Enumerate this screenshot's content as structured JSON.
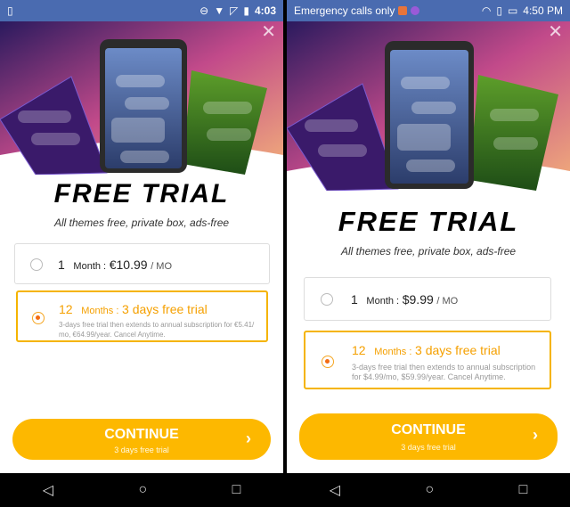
{
  "left": {
    "statusbar": {
      "time": "4:03"
    },
    "title": "FREE  TRIAL",
    "subtitle": "All themes free, private box, ads-free",
    "option1": {
      "num": "1",
      "unit": "Month :",
      "price": "€10.99",
      "per": "/ MO"
    },
    "option2": {
      "num": "12",
      "unit": "Months :",
      "headline": "3 days free trial",
      "desc": "3-days free trial then extends to annual subscription for €5.41/ mo, €64.99/year. Cancel Anytime."
    },
    "button": {
      "label": "CONTINUE",
      "sub": "3 days free trial"
    }
  },
  "right": {
    "statusbar": {
      "left_text": "Emergency calls only",
      "time": "4:50 PM"
    },
    "title": "FREE  TRIAL",
    "subtitle": "All themes free, private box, ads-free",
    "option1": {
      "num": "1",
      "unit": "Month :",
      "price": "$9.99",
      "per": "/ MO"
    },
    "option2": {
      "num": "12",
      "unit": "Months :",
      "headline": "3 days free trial",
      "desc": "3-days free trial then extends to annual subscription for $4.99/mo, $59.99/year. Cancel Anytime."
    },
    "button": {
      "label": "CONTINUE",
      "sub": "3 days free trial"
    }
  },
  "icons": {
    "close": "close-icon",
    "next": "chevron-right-icon",
    "back": "nav-back-icon",
    "home": "nav-home-icon",
    "recents": "nav-recents-icon"
  },
  "colors": {
    "accent": "#fdb800",
    "selected_border": "#f5b400",
    "trial_text": "#f5a000",
    "statusbar": "#4a6bb0"
  }
}
